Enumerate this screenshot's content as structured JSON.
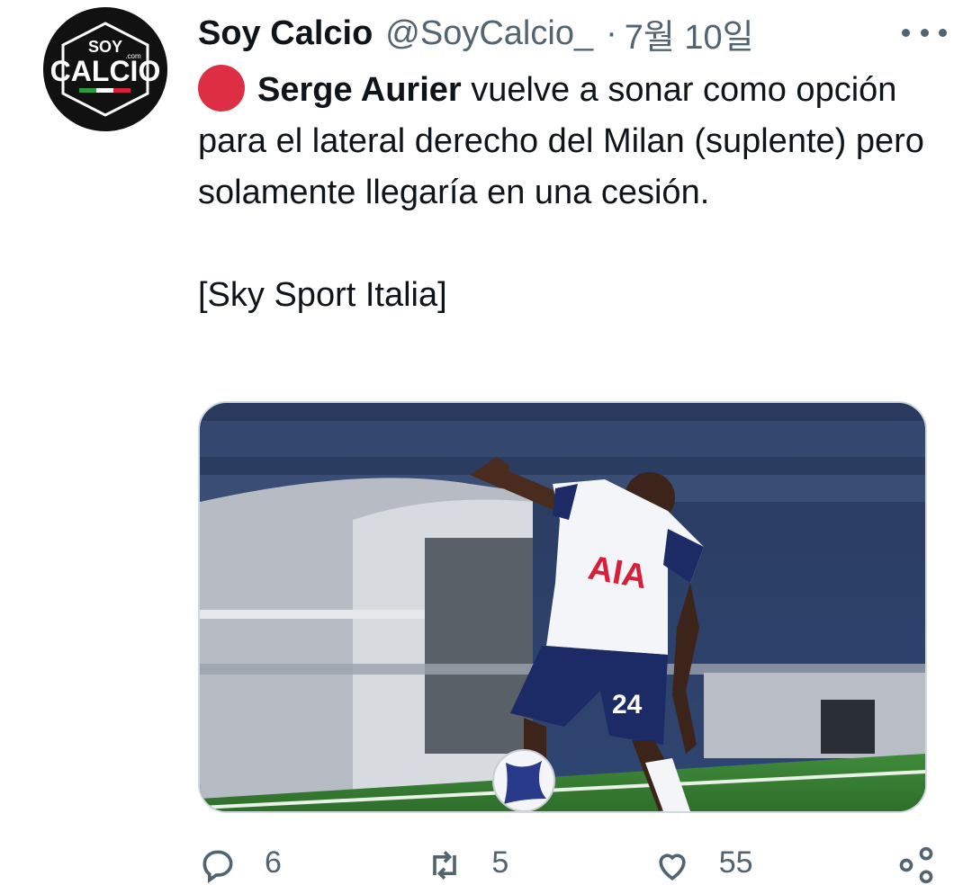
{
  "tweet": {
    "author_name": "Soy Calcio",
    "author_handle": "@SoyCalcio_",
    "separator": "·",
    "date": "7월 10일",
    "text": {
      "mention": "Serge Aurier",
      "line1_rest": " vuelve a sonar como opción para el lateral derecho del Milan (suplente) pero solamente llegaría en una cesión.",
      "source": "[Sky Sport Italia]"
    },
    "avatar": {
      "top_text": "SOY",
      "main_text": "CALCIO",
      "suffix": ".com"
    },
    "media": {
      "shirt_sponsor": "AIA",
      "shorts_number": "24"
    }
  },
  "actions": {
    "reply_count": "6",
    "retweet_count": "5",
    "like_count": "55"
  },
  "colors": {
    "accent_red": "#dd2e44",
    "secondary_text": "#536471",
    "primary_text": "#0f1419",
    "media_border": "#cfd9de"
  },
  "icons": [
    "more-icon",
    "red-circle-icon",
    "reply-icon",
    "retweet-icon",
    "like-icon",
    "share-icon"
  ]
}
